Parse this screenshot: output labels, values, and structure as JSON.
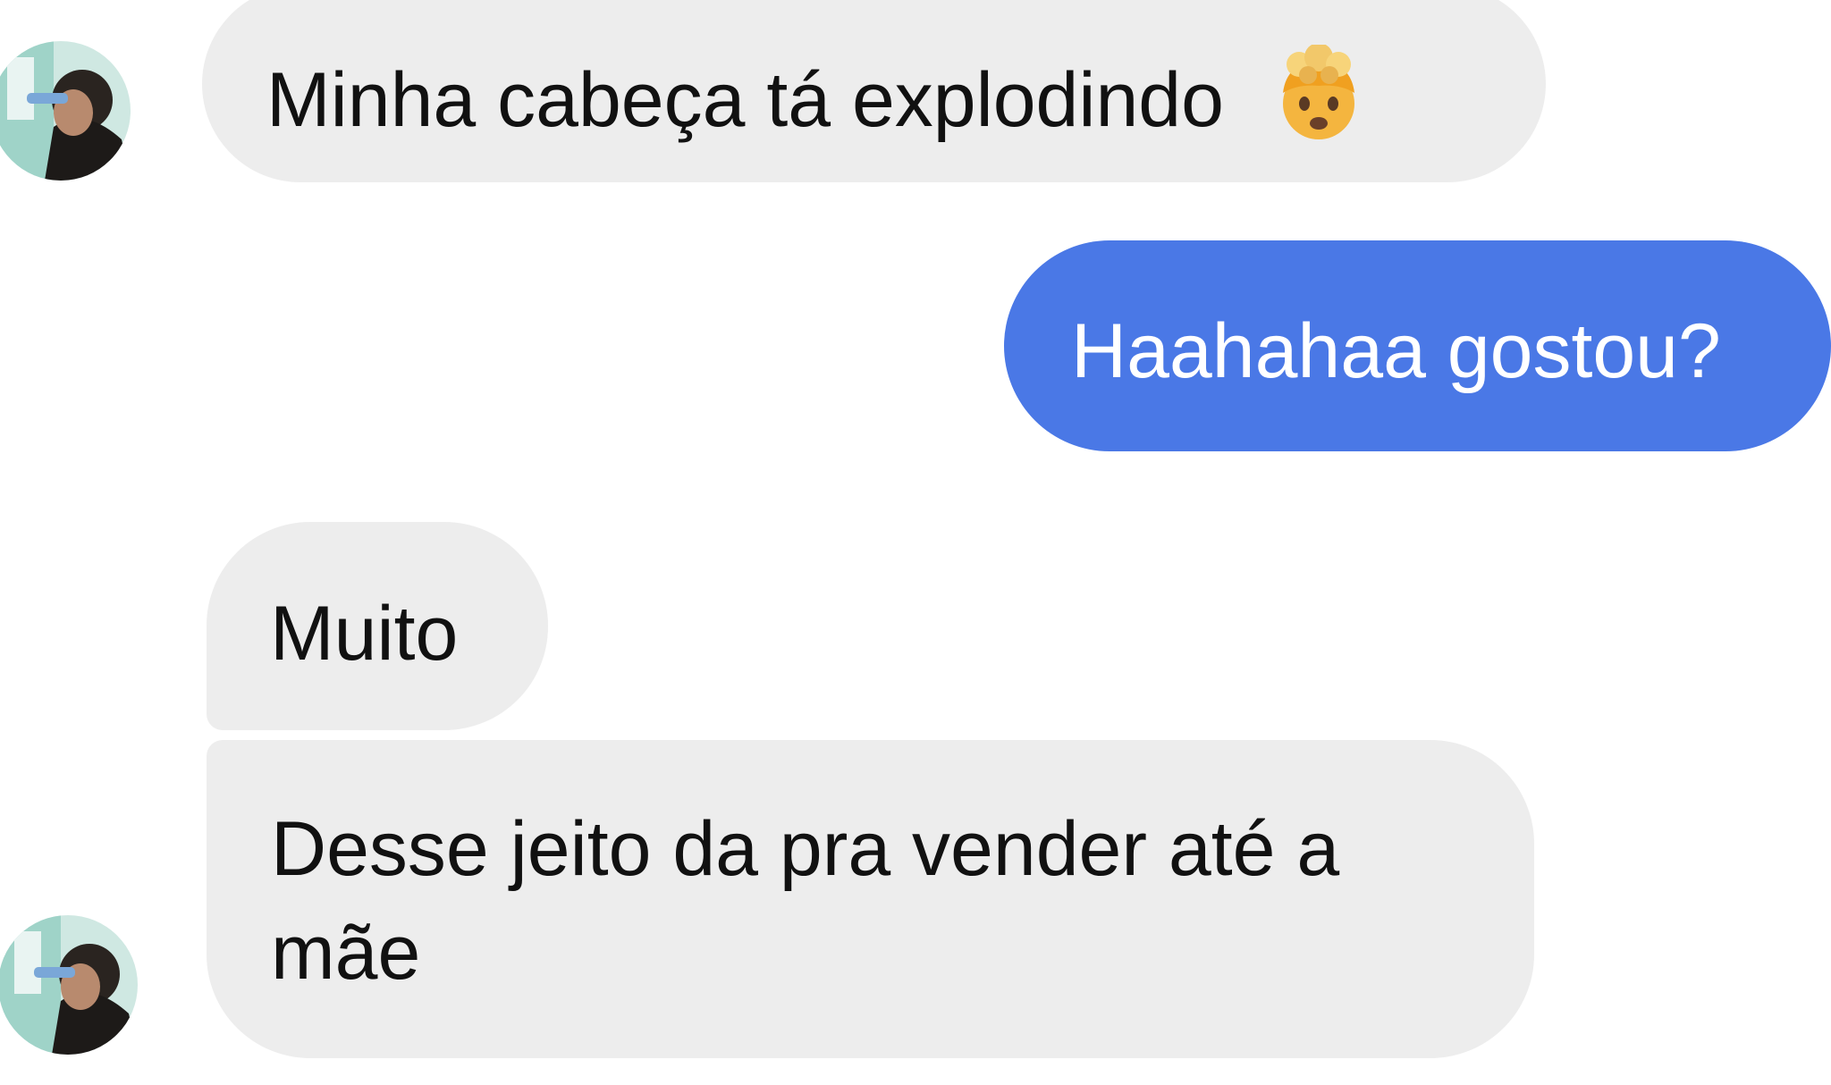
{
  "conversation": {
    "messages": [
      {
        "sender": "contact",
        "text": "Minha cabeça tá explodindo",
        "emoji": "exploding-head-emoji"
      },
      {
        "sender": "me",
        "text": "Haahahaa gostou?"
      },
      {
        "sender": "contact",
        "text": "Muito"
      },
      {
        "sender": "contact",
        "text_line1": "Desse jeito da pra vender até a",
        "text_line2": "mãe"
      }
    ]
  },
  "colors": {
    "background": "#ffffff",
    "incoming_bubble": "#ededed",
    "outgoing_bubble": "#4a78e6",
    "incoming_text": "#111111",
    "outgoing_text": "#ffffff"
  },
  "icons": {
    "avatar": "contact-avatar",
    "emoji": "exploding-head-emoji"
  }
}
